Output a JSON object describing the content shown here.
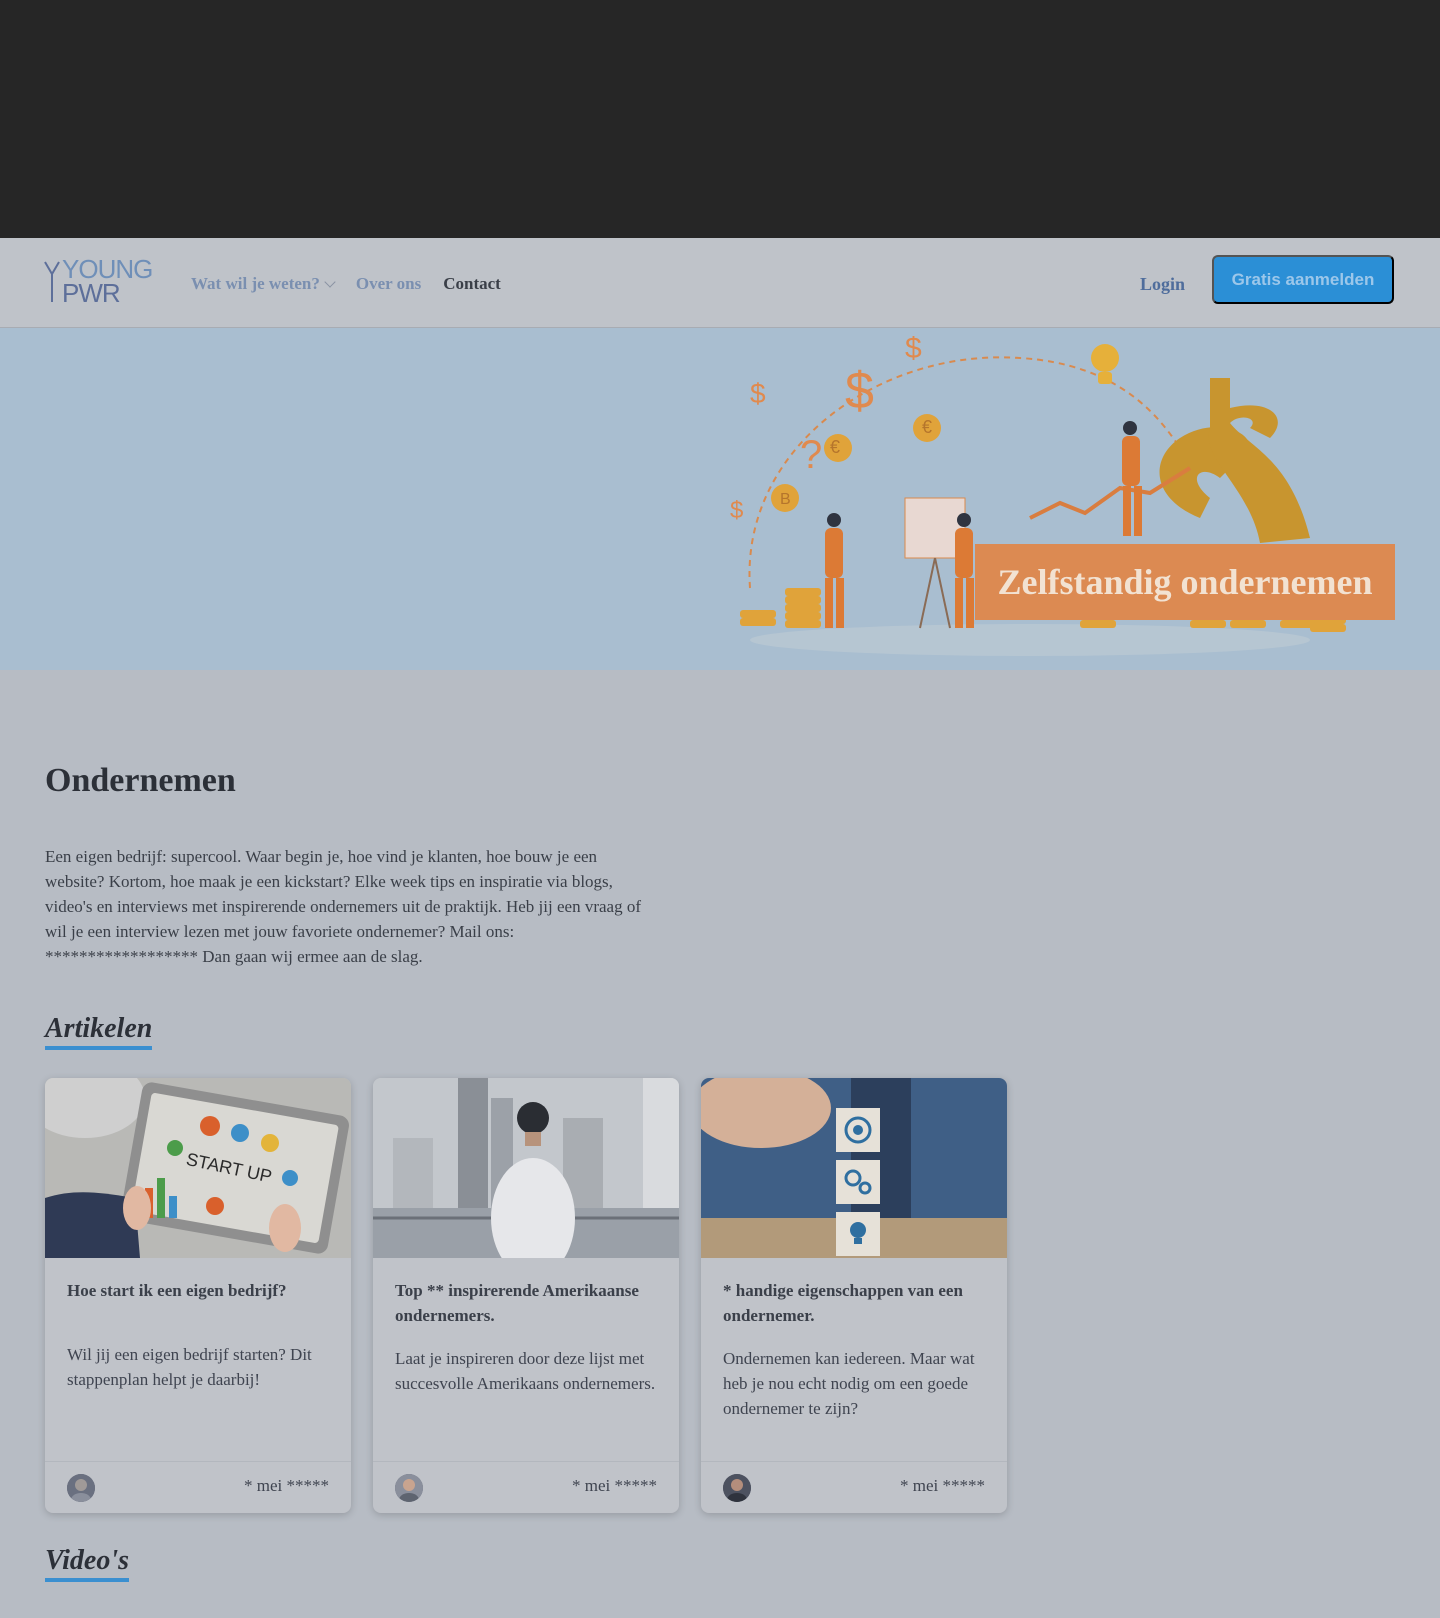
{
  "header": {
    "logo_line1": "YOUNG",
    "logo_line2": "PWR",
    "nav": [
      {
        "label": "Wat wil je weten?",
        "has_dropdown": true
      },
      {
        "label": "Over ons"
      },
      {
        "label": "Contact"
      }
    ],
    "login_label": "Login",
    "signup_label": "Gratis aanmelden"
  },
  "hero": {
    "badge": "Zelfstandig ondernemen"
  },
  "main": {
    "title": "Ondernemen",
    "intro": "Een eigen bedrijf: supercool. Waar begin je, hoe vind je klanten, hoe bouw je een website? Kortom, hoe maak je een kickstart? Elke week tips en inspiratie via blogs, video's en interviews met inspirerende ondernemers uit de praktijk. Heb jij een vraag of wil je een interview lezen met jouw favoriete ondernemer? Mail ons: ****************** Dan gaan wij ermee aan de slag.",
    "articles_heading": "Artikelen",
    "videos_heading": "Video's",
    "articles": [
      {
        "title": "Hoe start ik een eigen bedrijf?",
        "description": "Wil jij een eigen bedrijf starten? Dit stappenplan helpt je daarbij!",
        "date": "* mei *****",
        "image_label": "START UP"
      },
      {
        "title": "Top ** inspirerende Amerikaanse ondernemers.",
        "description": "Laat je inspireren door deze lijst met succesvolle Amerikaans ondernemers.",
        "date": "* mei *****"
      },
      {
        "title": "* handige eigenschappen van een ondernemer.",
        "description": "Ondernemen kan iedereen. Maar wat heb je nou echt nodig om een goede ondernemer te zijn?",
        "date": "* mei *****"
      }
    ]
  },
  "colors": {
    "accent": "#2b8fd6",
    "badge": "#dc8a52",
    "hero_bg": "#a9bed0",
    "topbar": "#262626"
  }
}
